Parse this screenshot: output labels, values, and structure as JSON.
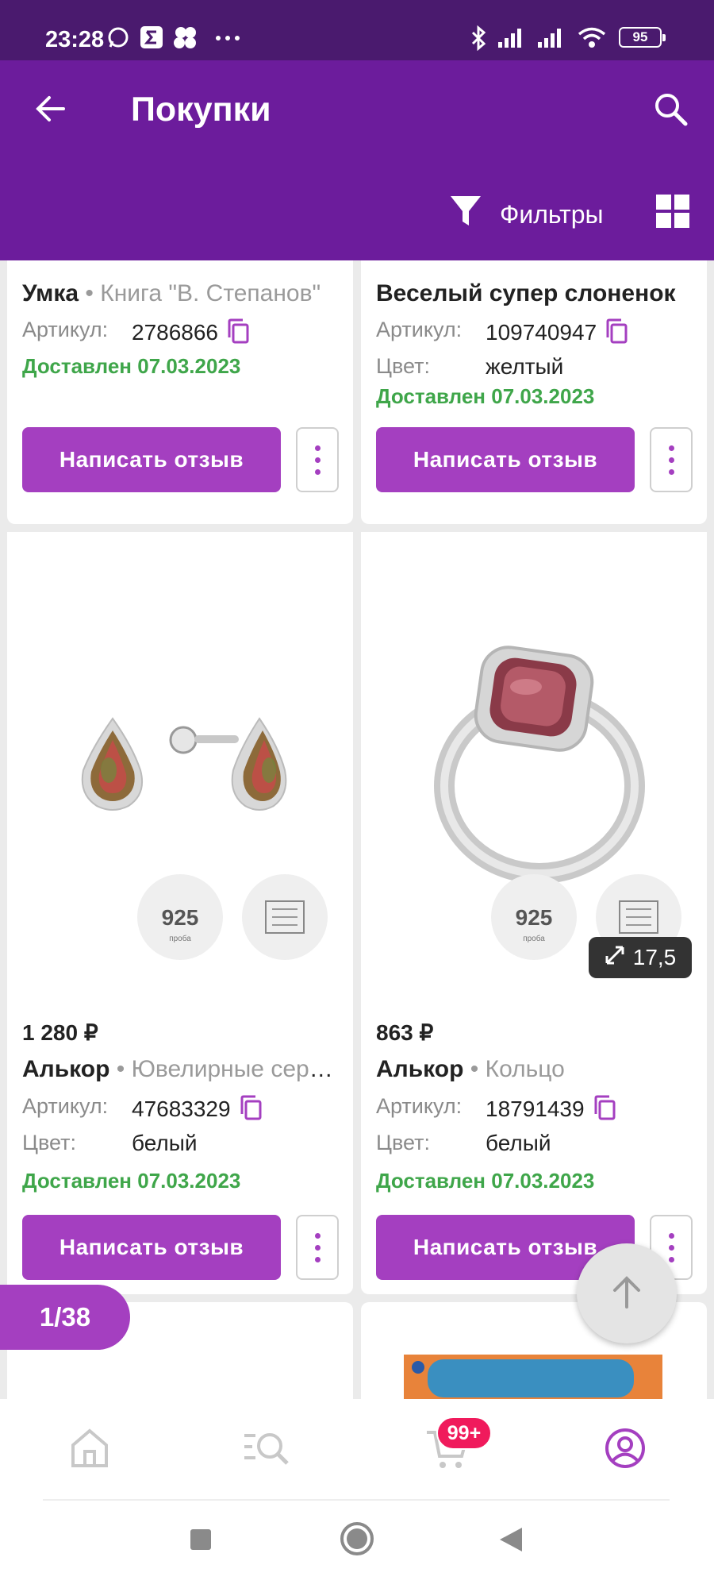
{
  "status_bar": {
    "time": "23:28",
    "battery": "95",
    "icons": [
      "whatsapp-icon",
      "sigma-icon",
      "app-icon",
      "more-dots-icon",
      "bluetooth-icon",
      "signal-icon",
      "signal-icon",
      "wifi-icon"
    ]
  },
  "header": {
    "title": "Покупки",
    "filter_label": "Фильтры"
  },
  "cards": [
    {
      "brand": "Умка",
      "product": "Книга \"В. Степанов\"",
      "article_label": "Артикул:",
      "article": "2786866",
      "status": "Доставлен 07.03.2023",
      "review_label": "Написать отзыв"
    },
    {
      "brand": "Веселый супер слоненок",
      "product": "",
      "article_label": "Артикул:",
      "article": "109740947",
      "color_label": "Цвет:",
      "color": "желтый",
      "status": "Доставлен 07.03.2023",
      "review_label": "Написать отзыв"
    },
    {
      "price": "1 280 ₽",
      "brand": "Алькор",
      "product": "Ювелирные серьги",
      "article_label": "Артикул:",
      "article": "47683329",
      "color_label": "Цвет:",
      "color": "белый",
      "status": "Доставлен 07.03.2023",
      "review_label": "Написать отзыв",
      "badges": [
        "925",
        "проба"
      ]
    },
    {
      "price": "863 ₽",
      "brand": "Алькор",
      "product": "Кольцо",
      "article_label": "Артикул:",
      "article": "18791439",
      "color_label": "Цвет:",
      "color": "белый",
      "status": "Доставлен 07.03.2023",
      "review_label": "Написать отзыв",
      "size": "17,5",
      "badges": [
        "925",
        "проба"
      ]
    }
  ],
  "page_counter": "1/38",
  "bottom_nav": {
    "items": [
      "home-icon",
      "catalog-search-icon",
      "cart-icon",
      "profile-icon"
    ],
    "active": "profile-icon",
    "cart_badge": "99+"
  },
  "colors": {
    "status_bar": "#4a1a6e",
    "header": "#6c1c9c",
    "accent": "#a43fc0",
    "delivered": "#3fa64a",
    "cart_badge": "#f01a5c"
  }
}
